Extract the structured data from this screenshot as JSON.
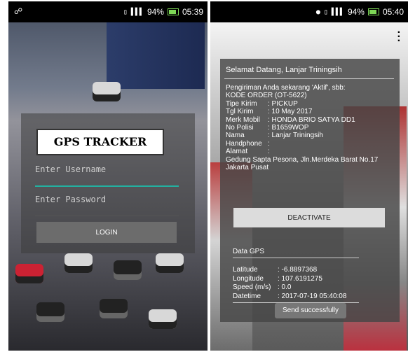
{
  "screen1": {
    "status": {
      "battery": "94%",
      "time": "05:39"
    },
    "app_title": "GPS TRACKER",
    "username_placeholder": "Enter Username",
    "password_placeholder": "Enter Password",
    "login_label": "LOGIN"
  },
  "screen2": {
    "status": {
      "battery": "94%",
      "time": "05:40"
    },
    "welcome": "Selamat Datang, Lanjar Triningsih",
    "intro": "Pengiriman Anda sekarang 'Aktif', sbb:",
    "kode_order": "KODE ORDER (OT-5622)",
    "fields": [
      {
        "k": "Tipe Kirim",
        "v": ": PICKUP"
      },
      {
        "k": "Tgl Kirim",
        "v": ": 10 May 2017"
      },
      {
        "k": "Merk Mobil",
        "v": ": HONDA BRIO SATYA DD1"
      },
      {
        "k": "No Polisi",
        "v": ": B1659WOP"
      },
      {
        "k": "Nama",
        "v": ": Lanjar Triningsih"
      },
      {
        "k": "Handphone",
        "v": ":"
      },
      {
        "k": "Alamat",
        "v": ":"
      }
    ],
    "address_line1": "Gedung Sapta Pesona, Jln.Merdeka Barat No.17",
    "address_line2": "Jakarta Pusat",
    "deactivate_label": "DEACTIVATE",
    "gps_title": "Data GPS",
    "gps": [
      {
        "k": "Latitude",
        "v": ": -6.8897368"
      },
      {
        "k": "Longitude",
        "v": ": 107.6191275"
      },
      {
        "k": "Speed (m/s)",
        "v": ": 0.0"
      },
      {
        "k": "Datetime",
        "v": ": 2017-07-19 05:40:08"
      }
    ],
    "toast": "Send successfully",
    "menu_icon": "overflow-menu-icon"
  }
}
